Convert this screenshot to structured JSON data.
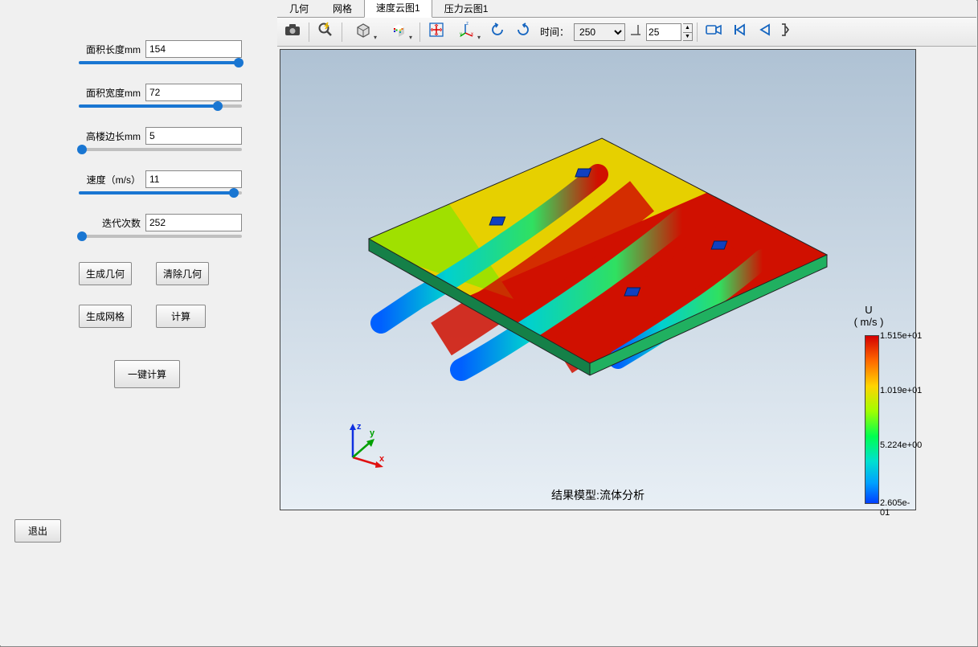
{
  "sidebar": {
    "params": [
      {
        "label": "面积长度mm",
        "value": "154",
        "slider_pct": 98
      },
      {
        "label": "面积宽度mm",
        "value": "72",
        "slider_pct": 85
      },
      {
        "label": "高楼边长mm",
        "value": "5",
        "slider_pct": 2
      },
      {
        "label": "速度（m/s）",
        "value": "11",
        "slider_pct": 95
      },
      {
        "label": "迭代次数",
        "value": "252",
        "slider_pct": 2
      }
    ],
    "buttons": {
      "gen_geom": "生成几何",
      "clear_geom": "清除几何",
      "gen_mesh": "生成网格",
      "calculate": "计算",
      "one_click": "一键计算",
      "exit": "退出"
    }
  },
  "tabs": [
    {
      "label": "几何",
      "active": false
    },
    {
      "label": "网格",
      "active": false
    },
    {
      "label": "速度云图1",
      "active": true
    },
    {
      "label": "压力云图1",
      "active": false
    }
  ],
  "toolbar": {
    "time_label": "时间：",
    "time_value": "250",
    "frame_value": "25"
  },
  "viewport": {
    "result_label": "结果模型:流体分析",
    "axes": {
      "x": "x",
      "y": "y",
      "z": "z"
    }
  },
  "colorbar": {
    "title_line1": "U",
    "title_line2": "( m/s )",
    "ticks": [
      {
        "label": "1.515e+01",
        "pos": 0
      },
      {
        "label": "1.019e+01",
        "pos": 33
      },
      {
        "label": "5.224e+00",
        "pos": 66
      },
      {
        "label": "2.605e-01",
        "pos": 100
      }
    ]
  }
}
